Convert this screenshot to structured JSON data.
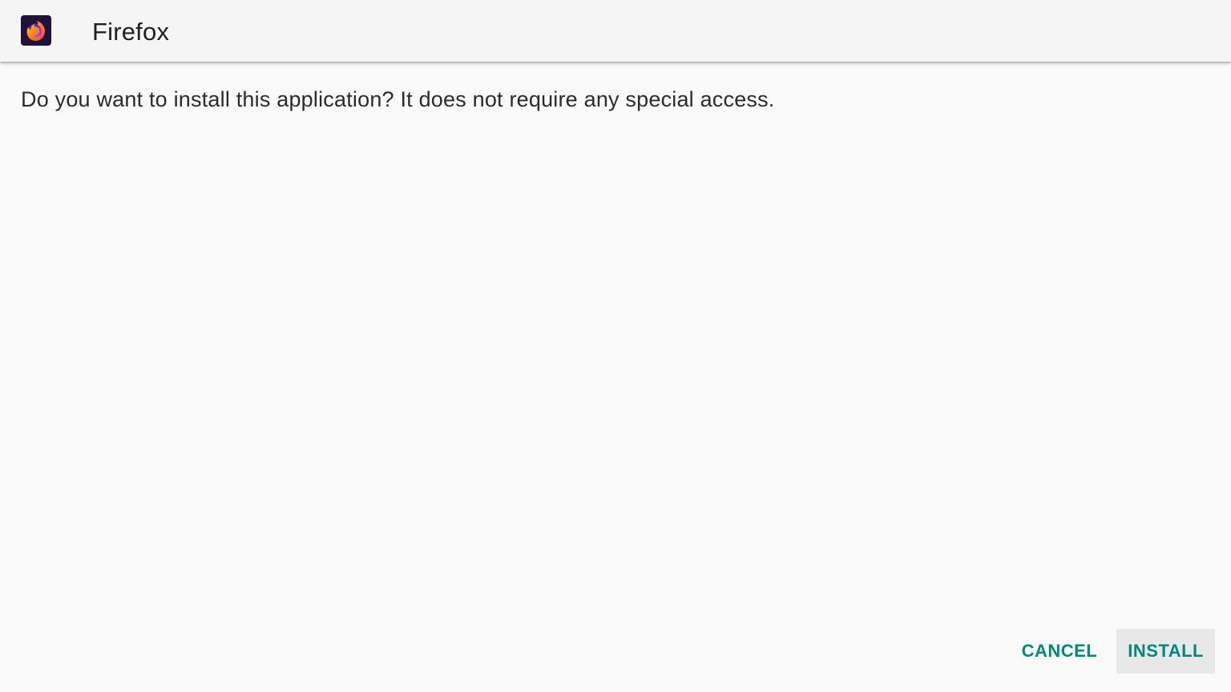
{
  "header": {
    "app_name": "Firefox",
    "icon": "firefox-icon"
  },
  "body": {
    "message": "Do you want to install this application? It does not require any special access."
  },
  "actions": {
    "cancel_label": "CANCEL",
    "install_label": "INSTALL"
  },
  "colors": {
    "accent": "#00897b",
    "header_bg": "#f5f5f5",
    "page_bg": "#fafafa",
    "install_button_bg": "#e8e8e8"
  }
}
